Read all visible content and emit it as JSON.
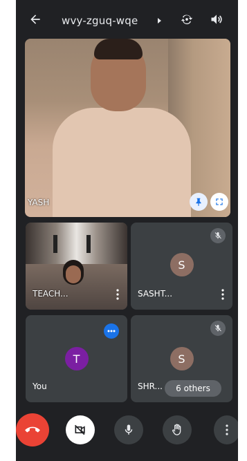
{
  "header": {
    "meeting_code": "wvy-zguq-wqe"
  },
  "main_tile": {
    "name": "YASH"
  },
  "tiles": [
    {
      "name": "TEACH...",
      "type": "video"
    },
    {
      "name": "SASHT...",
      "avatar_letter": "S",
      "avatar_color": "#8d6e63",
      "muted": true
    },
    {
      "name": "You",
      "avatar_letter": "T",
      "avatar_color": "#7b1fa2"
    },
    {
      "name": "SHR...",
      "avatar_letter": "S",
      "avatar_color": "#8d6e63",
      "muted": true
    }
  ],
  "others_label": "6 others",
  "colors": {
    "background": "#202124",
    "tile": "#3c4043",
    "end_call": "#ea4335",
    "accent_blue": "#1a73e8"
  },
  "icons": {
    "back": "arrow-left-icon",
    "flip": "camera-flip-icon",
    "volume": "volume-icon",
    "pin": "pin-icon",
    "fullscreen": "fullscreen-icon",
    "mute": "mic-off-icon",
    "more_dots": "more-dots-icon",
    "end_call": "end-call-icon",
    "camera_off": "camera-off-icon",
    "mic": "mic-icon",
    "hand": "raise-hand-icon",
    "more": "more-vert-icon"
  }
}
